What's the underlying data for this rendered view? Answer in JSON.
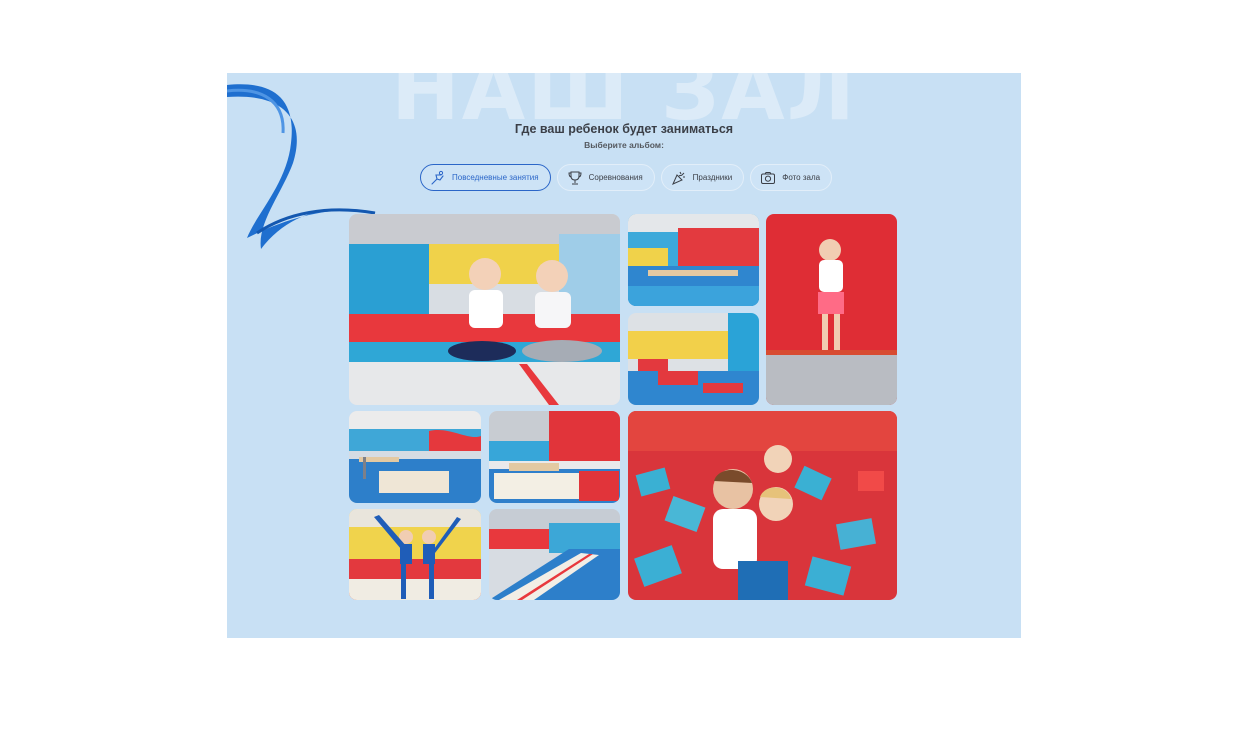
{
  "section": {
    "watermark": "НАШ ЗАЛ",
    "title": "Где ваш ребенок будет заниматься",
    "subtitle": "Выберите альбом:"
  },
  "tabs": [
    {
      "label": "Повседневные занятия",
      "icon": "gymnast-icon",
      "active": true
    },
    {
      "label": "Соревнования",
      "icon": "trophy-icon",
      "active": false
    },
    {
      "label": "Праздники",
      "icon": "confetti-icon",
      "active": false
    },
    {
      "label": "Фото зала",
      "icon": "camera-icon",
      "active": false
    }
  ],
  "colors": {
    "background": "#c8e0f4",
    "accent": "#2b66c8",
    "ribbon": "#1f6fcf",
    "mat_red": "#e8383d",
    "mat_blue": "#2fa7d6"
  },
  "gallery": [
    {
      "name": "photo-two-girls-sitting"
    },
    {
      "name": "photo-gym-red-wall"
    },
    {
      "name": "photo-girl-jumping-trampoline"
    },
    {
      "name": "photo-gym-hall-wide"
    },
    {
      "name": "photo-gym-beams"
    },
    {
      "name": "photo-gym-vault"
    },
    {
      "name": "photo-foam-pit-kids"
    },
    {
      "name": "photo-two-girls-splits"
    },
    {
      "name": "photo-gym-runway"
    }
  ]
}
